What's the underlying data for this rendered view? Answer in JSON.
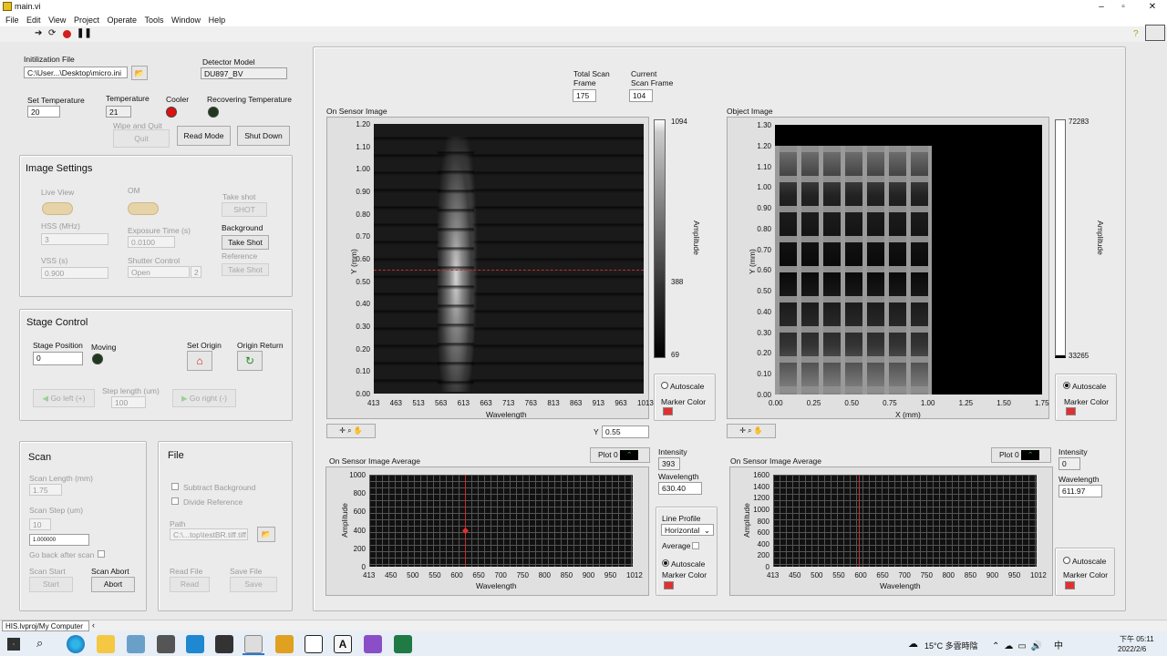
{
  "window": {
    "title": "main.vi"
  },
  "menu": [
    "File",
    "Edit",
    "View",
    "Project",
    "Operate",
    "Tools",
    "Window",
    "Help"
  ],
  "init": {
    "label": "Initilization File",
    "value": "C:\\User...\\Desktop\\micro.ini"
  },
  "detector": {
    "label": "Detector Model",
    "value": "DU897_BV"
  },
  "temps": {
    "set_label": "Set Temperature",
    "set_value": "20",
    "temp_label": "Temperature",
    "temp_value": "21",
    "cooler_label": "Cooler",
    "recover_label": "Recovering Temperature"
  },
  "buttons": {
    "wipe_label": "Wipe and Quit",
    "quit": "Quit",
    "read_mode": "Read Mode",
    "shut_down": "Shut Down"
  },
  "image_settings": {
    "title": "Image Settings",
    "live_view": "Live View",
    "om": "OM",
    "take_shot_label": "Take shot",
    "shot": "SHOT",
    "hss_label": "HSS (MHz)",
    "hss_value": "3",
    "exposure_label": "Exposure Time (s)",
    "exposure_value": "0.0100",
    "background_label": "Background",
    "background_btn": "Take Shot",
    "reference_label": "Reference",
    "reference_btn": "Take Shot",
    "vss_label": "VSS (s)",
    "vss_value": "0.900",
    "shutter_label": "Shutter Control",
    "shutter_value": "Open",
    "shutter_num": "2"
  },
  "stage": {
    "title": "Stage Control",
    "position_label": "Stage Position",
    "position_value": "0",
    "moving_label": "Moving",
    "set_origin": "Set Origin",
    "origin_return": "Origin Return",
    "go_left": "Go left (+)",
    "step_label": "Step length (um)",
    "step_value": "100",
    "go_right": "Go right (-)"
  },
  "scan": {
    "title": "Scan",
    "length_label": "Scan Length (mm)",
    "length_value": "1.75",
    "step_label": "Scan Step (um)",
    "step_value": "10",
    "step_value2": "1.000000",
    "go_back": "Go back after scan",
    "start_label": "Scan Start",
    "start_btn": "Start",
    "abort_label": "Scan Abort",
    "abort_btn": "Abort"
  },
  "file": {
    "title": "File",
    "subtract": "Subtract Background",
    "divide": "Divide Reference",
    "path_label": "Path",
    "path_value": "C:\\...top\\testBR.tiff.tiff",
    "read_label": "Read File",
    "read_btn": "Read",
    "save_label": "Save File",
    "save_btn": "Save"
  },
  "frames": {
    "total_label": "Total Scan Frame",
    "total_value": "175",
    "current_label": "Current Scan Frame",
    "current_value": "104"
  },
  "sensor": {
    "title": "On Sensor Image",
    "ylabel": "Y (mm)",
    "xlabel": "Wavelength",
    "yticks": [
      "1.20",
      "1.10",
      "1.00",
      "0.90",
      "0.80",
      "0.70",
      "0.60",
      "0.50",
      "0.40",
      "0.30",
      "0.20",
      "0.10",
      "0.00"
    ],
    "xticks": [
      "413",
      "463",
      "513",
      "563",
      "613",
      "663",
      "713",
      "763",
      "813",
      "863",
      "913",
      "963",
      "1013"
    ],
    "scale_label": "Amplitude",
    "scale_top": "1094",
    "scale_mid": "388",
    "scale_bot": "69",
    "autoscale": "Autoscale",
    "marker_color": "Marker Color",
    "y_label": "Y",
    "y_value": "0.55"
  },
  "object": {
    "title": "Object Image",
    "ylabel": "Y (mm)",
    "xlabel": "X (mm)",
    "yticks": [
      "1.30",
      "1.20",
      "1.10",
      "1.00",
      "0.90",
      "0.80",
      "0.70",
      "0.60",
      "0.50",
      "0.40",
      "0.30",
      "0.20",
      "0.10",
      "0.00"
    ],
    "xticks": [
      "0.00",
      "0.25",
      "0.50",
      "0.75",
      "1.00",
      "1.25",
      "1.50",
      "1.75"
    ],
    "scale_label": "Amplitude",
    "scale_top": "72283",
    "scale_bot": "33265",
    "autoscale": "Autoscale",
    "marker_color": "Marker Color"
  },
  "avg1": {
    "title": "On Sensor Image Average",
    "plot": "Plot 0",
    "ylabel": "Amplitude",
    "xlabel": "Wavelength",
    "yticks": [
      "1000",
      "800",
      "600",
      "400",
      "200",
      "0"
    ],
    "xticks": [
      "413",
      "450",
      "500",
      "550",
      "600",
      "650",
      "700",
      "750",
      "800",
      "850",
      "900",
      "950",
      "1012"
    ],
    "intensity_label": "Intensity",
    "intensity_value": "393",
    "wavelength_label": "Wavelength",
    "wavelength_value": "630.40",
    "line_profile": "Line Profile",
    "line_profile_value": "Horizontal",
    "average": "Average",
    "autoscale": "Autoscale",
    "marker_color": "Marker Color"
  },
  "avg2": {
    "title": "On Sensor Image Average",
    "plot": "Plot 0",
    "ylabel": "Amplitude",
    "xlabel": "Wavelength",
    "yticks": [
      "1600",
      "1400",
      "1200",
      "1000",
      "800",
      "600",
      "400",
      "200",
      "0"
    ],
    "xticks": [
      "413",
      "450",
      "500",
      "550",
      "600",
      "650",
      "700",
      "750",
      "800",
      "850",
      "900",
      "950",
      "1012"
    ],
    "intensity_label": "Intensity",
    "intensity_value": "0",
    "wavelength_label": "Wavelength",
    "wavelength_value": "611.97",
    "autoscale": "Autoscale",
    "marker_color": "Marker Color"
  },
  "status": {
    "path": "HIS.lvproj/My Computer"
  },
  "tray": {
    "weather": "15°C 多雲時陰",
    "time": "下午 05:11",
    "date": "2022/2/6"
  },
  "colors": {
    "marker": "#e03030",
    "led_red": "#e01010",
    "led_off": "#204020"
  }
}
